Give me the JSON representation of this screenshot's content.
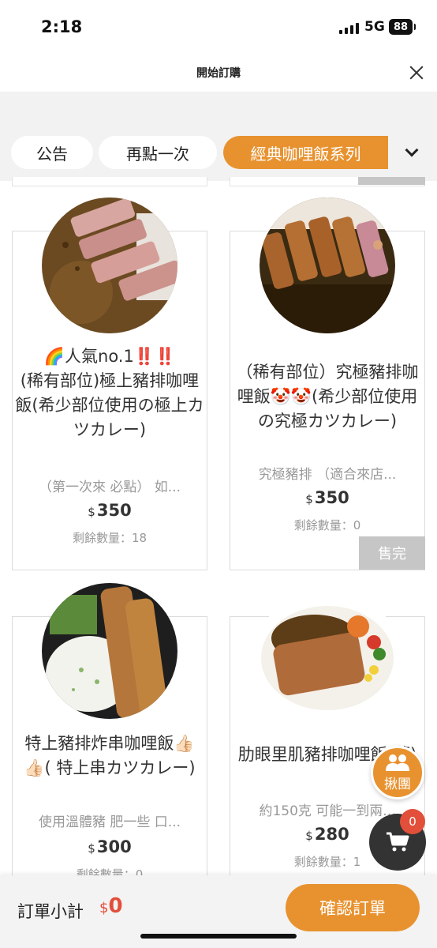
{
  "status_bar": {
    "time": "2:18",
    "network": "5G",
    "battery": "88"
  },
  "header": {
    "title": "開始訂購"
  },
  "tabs": [
    {
      "label": "公告"
    },
    {
      "label": "再點一次"
    },
    {
      "label": "經典咖哩飯系列"
    }
  ],
  "products": [
    {
      "title": "🌈人氣no.1‼️‼️\n(稀有部位)極上豬排咖哩飯(希少部位使用の極上カツカレー)",
      "description": "（第一次來 必點） 如...",
      "currency": "$",
      "price": "350",
      "stock": "剩餘數量：18"
    },
    {
      "title": "（稀有部位）究極豬排咖哩飯🤡🤡(希少部位使用の究極カツカレー)",
      "description": "究極豬排 （適合來店...",
      "currency": "$",
      "price": "350",
      "stock": "剩餘數量：0",
      "sold_out": "售完"
    },
    {
      "title": "特上豬排炸串咖哩飯👍🏻👍🏻( 特上串カツカレー)",
      "description": "使用溫體豬 肥一些 口...",
      "currency": "$",
      "price": "300",
      "stock": "剩餘數量：0"
    },
    {
      "title": "肋眼里肌豬排咖哩飯(薄)",
      "description": "約150克 可能一到兩...",
      "currency": "$",
      "price": "280",
      "stock": "剩餘數量：1"
    }
  ],
  "group_button": {
    "label": "揪團"
  },
  "cart": {
    "count": "0"
  },
  "footer": {
    "subtotal_label": "訂單小計",
    "subtotal_currency": "$",
    "subtotal_value": "0",
    "confirm_label": "確認訂單"
  },
  "colors": {
    "accent": "#e8922f",
    "badge": "#e24f3a",
    "sold_out": "#c6c6c6"
  }
}
